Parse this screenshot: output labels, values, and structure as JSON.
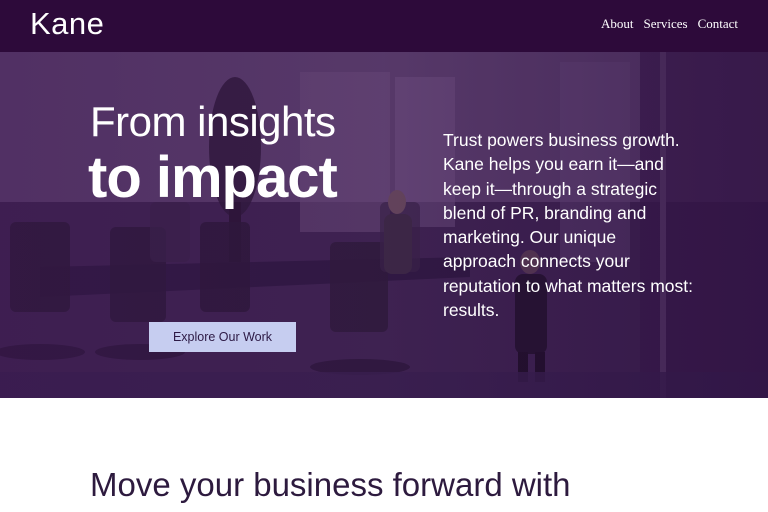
{
  "header": {
    "logo": "Kane",
    "nav": [
      {
        "label": "About"
      },
      {
        "label": "Services"
      },
      {
        "label": "Contact"
      }
    ]
  },
  "hero": {
    "headline_light": "From insights",
    "headline_bold": "to impact",
    "cta_label": "Explore Our Work",
    "copy": "Trust powers business growth. Kane helps you earn it—and keep it—through a strategic blend of PR, branding and marketing. Our unique approach connects your reputation to what matters most: results."
  },
  "section": {
    "title": "Move your business forward with"
  },
  "colors": {
    "header_bg": "#2d0a3a",
    "hero_tint": "#4b2c5e",
    "cta_bg": "#c6cdf0",
    "text_dark": "#2d1a3e"
  }
}
